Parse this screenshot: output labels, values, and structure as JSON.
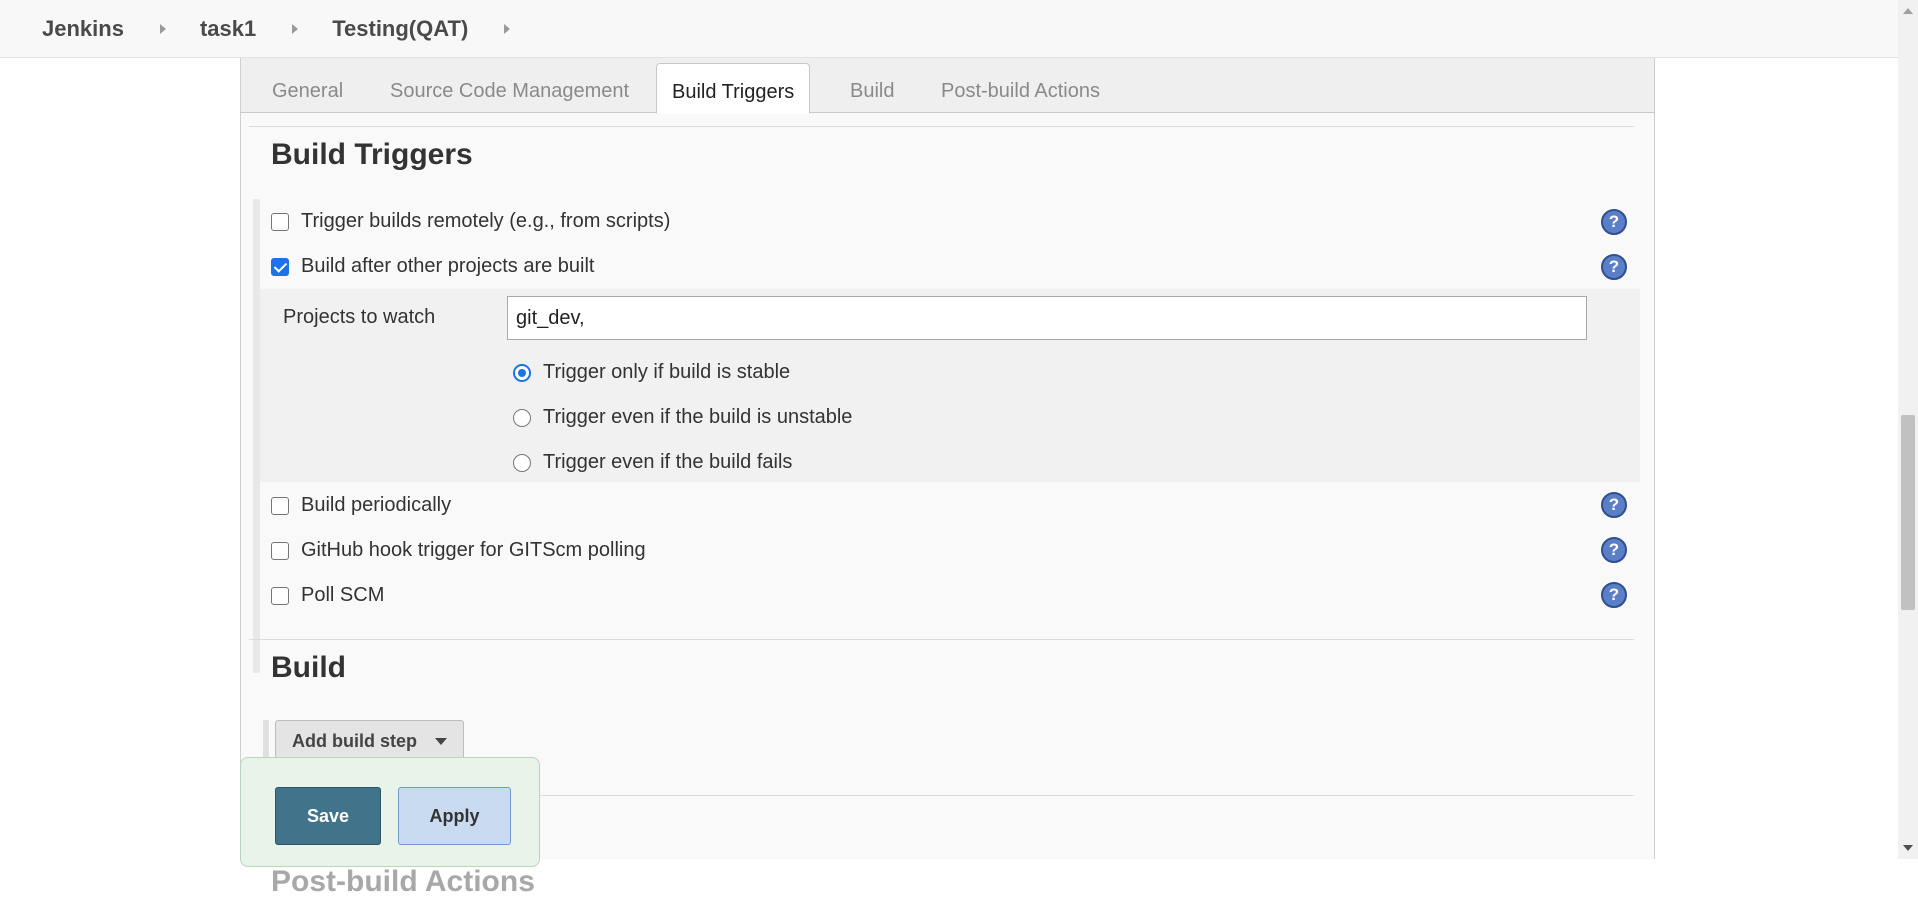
{
  "breadcrumb": {
    "items": [
      "Jenkins",
      "task1",
      "Testing(QAT)"
    ]
  },
  "tabs": [
    {
      "label": "General",
      "active": false
    },
    {
      "label": "Source Code Management",
      "active": false
    },
    {
      "label": "Build Triggers",
      "active": true
    },
    {
      "label": "Build",
      "active": false
    },
    {
      "label": "Post-build Actions",
      "active": false
    }
  ],
  "build_triggers": {
    "title": "Build Triggers",
    "options": [
      {
        "label": "Trigger builds remotely (e.g., from scripts)",
        "checked": false
      },
      {
        "label": "Build after other projects are built",
        "checked": true
      },
      {
        "label": "Build periodically",
        "checked": false
      },
      {
        "label": "GitHub hook trigger for GITScm polling",
        "checked": false
      },
      {
        "label": "Poll SCM",
        "checked": false
      }
    ],
    "projects_to_watch": {
      "label": "Projects to watch",
      "value": "git_dev,"
    },
    "radio_options": [
      {
        "label": "Trigger only if build is stable",
        "selected": true
      },
      {
        "label": "Trigger even if the build is unstable",
        "selected": false
      },
      {
        "label": "Trigger even if the build fails",
        "selected": false
      }
    ],
    "help_symbol": "?"
  },
  "build_section": {
    "title": "Build",
    "add_step_label": "Add build step"
  },
  "post_build_title_partial": "Post-build Actions",
  "actions": {
    "save_label": "Save",
    "apply_label": "Apply"
  },
  "icons": {
    "help": "help-icon",
    "caret": "caret-down-icon",
    "breadcrumb_sep": "chevron-right-icon"
  },
  "colors": {
    "accent_blue": "#1a73e8",
    "save_bg": "#41738b",
    "apply_bg": "#c9dbf0",
    "savebar_bg": "#e8f3ea",
    "help_bg": "#5b7fc7"
  }
}
